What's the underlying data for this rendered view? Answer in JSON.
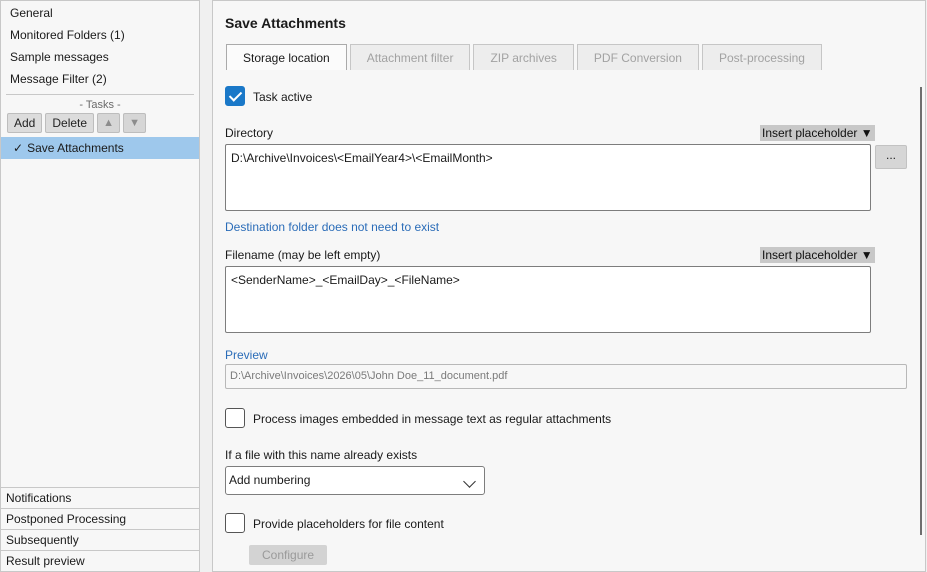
{
  "sidebar": {
    "nav": [
      {
        "label": "General"
      },
      {
        "label": "Monitored Folders (1)"
      },
      {
        "label": "Sample messages"
      },
      {
        "label": "Message Filter (2)"
      }
    ],
    "tasks_header": "- Tasks -",
    "buttons": {
      "add": "Add",
      "delete": "Delete",
      "up": "▲",
      "down": "▼"
    },
    "task_item": {
      "check": "✓",
      "label": "Save Attachments"
    },
    "bottom": [
      {
        "label": "Notifications"
      },
      {
        "label": "Postponed Processing"
      },
      {
        "label": "Subsequently"
      },
      {
        "label": "Result preview"
      }
    ]
  },
  "main": {
    "title": "Save Attachments",
    "tabs": [
      {
        "label": "Storage location",
        "active": true
      },
      {
        "label": "Attachment filter"
      },
      {
        "label": "ZIP archives"
      },
      {
        "label": "PDF Conversion"
      },
      {
        "label": "Post-processing"
      }
    ],
    "task_active": {
      "label": "Task active",
      "checked": true
    },
    "directory": {
      "label": "Directory",
      "insert_placeholder": "Insert placeholder ▼",
      "value": "D:\\Archive\\Invoices\\<EmailYear4>\\<EmailMonth>",
      "browse": "...",
      "hint": "Destination folder does not need to exist"
    },
    "filename": {
      "label": "Filename (may be left empty)",
      "insert_placeholder": "Insert placeholder ▼",
      "value": "<SenderName>_<EmailDay>_<FileName>"
    },
    "preview": {
      "label": "Preview",
      "value": "D:\\Archive\\Invoices\\2026\\05\\John Doe_11_document.pdf"
    },
    "embedded_images": {
      "label": "Process images embedded in message text as regular attachments",
      "checked": false
    },
    "exists": {
      "label": "If a file with this name already exists",
      "selected": "Add numbering"
    },
    "placeholders_content": {
      "label": "Provide placeholders for file content",
      "checked": false
    },
    "configure": "Configure"
  },
  "colors": {
    "accent": "#1a78c8",
    "selection": "#9ec8ec",
    "link": "#2a6cb8"
  }
}
